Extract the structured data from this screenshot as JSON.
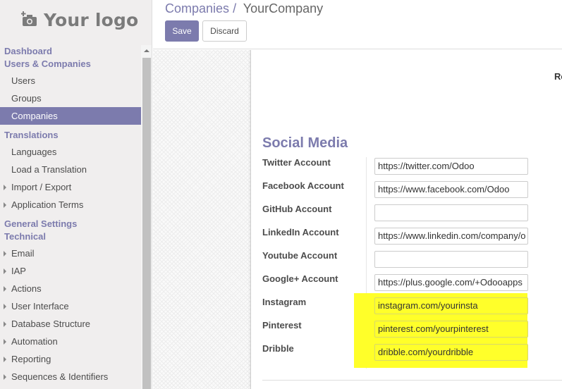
{
  "logo": {
    "text": "Your logo",
    "icon": "camera-plus-icon"
  },
  "sidebar": {
    "items": [
      {
        "type": "section",
        "label": "Dashboard"
      },
      {
        "type": "section",
        "label": "Users & Companies"
      },
      {
        "type": "item",
        "label": "Users"
      },
      {
        "type": "item",
        "label": "Groups"
      },
      {
        "type": "item",
        "label": "Companies",
        "active": true
      },
      {
        "type": "section",
        "label": "Translations"
      },
      {
        "type": "item",
        "label": "Languages"
      },
      {
        "type": "item",
        "label": "Load a Translation"
      },
      {
        "type": "item",
        "label": "Import / Export",
        "caret": true
      },
      {
        "type": "item",
        "label": "Application Terms",
        "caret": true
      },
      {
        "type": "section",
        "label": "General Settings"
      },
      {
        "type": "section",
        "label": "Technical"
      },
      {
        "type": "item",
        "label": "Email",
        "caret": true
      },
      {
        "type": "item",
        "label": "IAP",
        "caret": true
      },
      {
        "type": "item",
        "label": "Actions",
        "caret": true
      },
      {
        "type": "item",
        "label": "User Interface",
        "caret": true
      },
      {
        "type": "item",
        "label": "Database Structure",
        "caret": true
      },
      {
        "type": "item",
        "label": "Automation",
        "caret": true
      },
      {
        "type": "item",
        "label": "Reporting",
        "caret": true
      },
      {
        "type": "item",
        "label": "Sequences & Identifiers",
        "caret": true
      }
    ]
  },
  "breadcrumb": {
    "parent": "Companies",
    "separator": "/",
    "current": "YourCompany"
  },
  "buttons": {
    "save": "Save",
    "discard": "Discard"
  },
  "form": {
    "cut_label": "Re",
    "section_title": "Social Media",
    "fields": [
      {
        "label": "Twitter Account",
        "value": "https://twitter.com/Odoo",
        "highlight": false
      },
      {
        "label": "Facebook Account",
        "value": "https://www.facebook.com/Odoo",
        "highlight": false
      },
      {
        "label": "GitHub Account",
        "value": "",
        "highlight": false
      },
      {
        "label": "LinkedIn Account",
        "value": "https://www.linkedin.com/company/o",
        "highlight": false
      },
      {
        "label": "Youtube Account",
        "value": "",
        "highlight": false
      },
      {
        "label": "Google+ Account",
        "value": "https://plus.google.com/+Odooapps",
        "highlight": false
      },
      {
        "label": "Instagram",
        "value": "instagram.com/yourinsta",
        "highlight": true
      },
      {
        "label": "Pinterest",
        "value": "pinterest.com/yourpinterest",
        "highlight": true
      },
      {
        "label": "Dribble",
        "value": "dribble.com/yourdribble",
        "highlight": true
      }
    ]
  },
  "colors": {
    "accent": "#7c7bad",
    "highlight": "#ffff29"
  }
}
